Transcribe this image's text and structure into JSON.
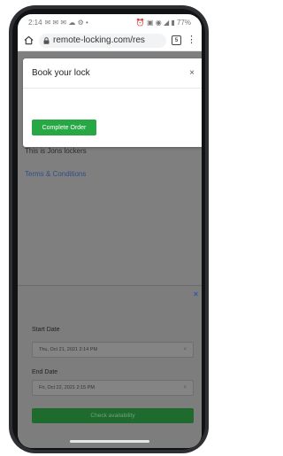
{
  "status_bar": {
    "time": "2:14",
    "notifications": "✉ ✉ ✉ ☁ ⚙ •",
    "right": "⏰ ▣ ◉ ◢ ▮ 77%"
  },
  "browser": {
    "url": "remote-locking.com/res",
    "tab_count": "5"
  },
  "modal": {
    "title": "Book your lock",
    "close_label": "×",
    "complete_button": "Complete Order"
  },
  "page": {
    "description": "This is Jons lockers",
    "terms_link": "Terms & Conditions"
  },
  "booking": {
    "close_label": "×",
    "start_label": "Start Date",
    "start_value": "Thu, Oct 21, 2021 2:14 PM",
    "end_label": "End Date",
    "end_value": "Fri, Oct 22, 2021 2:15 PM",
    "clear_label": "×",
    "check_button": "Check availability"
  },
  "colors": {
    "accent_green": "#28a745",
    "link_blue": "#2f4f8a"
  }
}
